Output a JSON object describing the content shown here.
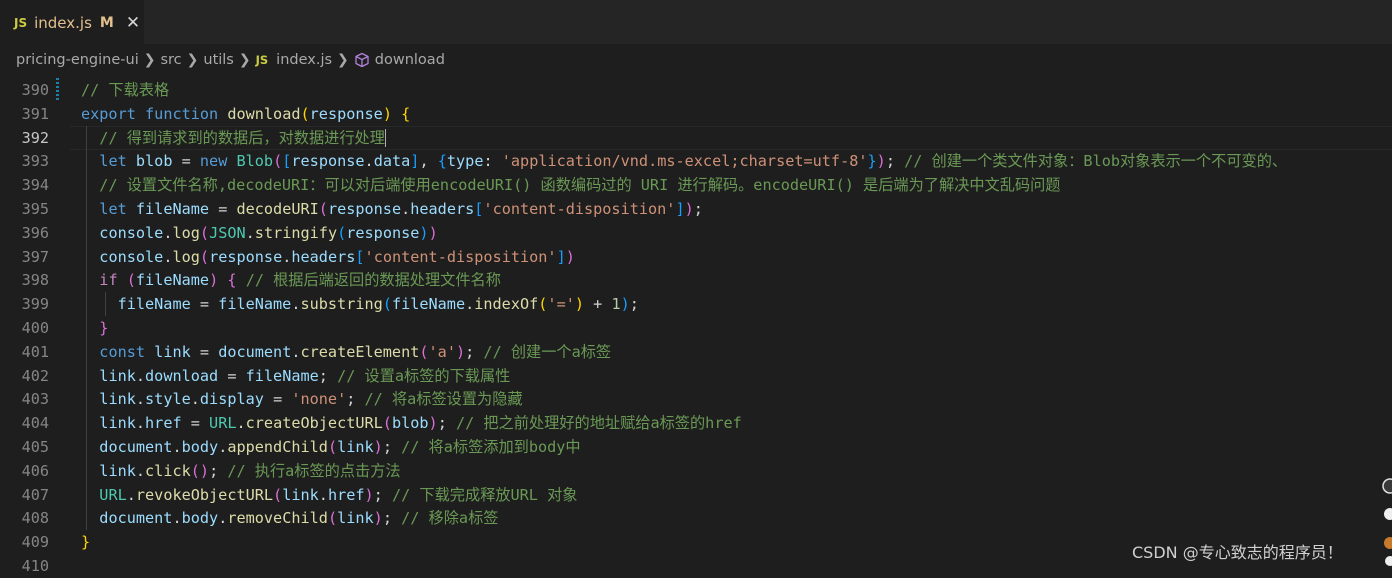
{
  "tab": {
    "icon": "JS",
    "filename": "index.js",
    "modified": "M",
    "close": "✕"
  },
  "breadcrumb": {
    "items": [
      "pricing-engine-ui",
      "src",
      "utils",
      "index.js",
      "download"
    ],
    "file_icon": "JS"
  },
  "lines": [
    {
      "n": "390",
      "tokens": [
        [
          "cmt",
          "// 下载表格"
        ]
      ]
    },
    {
      "n": "391",
      "tokens": [
        [
          "kw",
          "export"
        ],
        [
          "",
          " "
        ],
        [
          "kw",
          "function"
        ],
        [
          "",
          " "
        ],
        [
          "fn",
          "download"
        ],
        [
          "p1",
          "("
        ],
        [
          "var",
          "response"
        ],
        [
          "p1",
          ")"
        ],
        [
          "",
          " "
        ],
        [
          "p1",
          "{"
        ]
      ]
    },
    {
      "n": "392",
      "tokens": [
        [
          "",
          "  "
        ],
        [
          "cmt",
          "// 得到请求到的数据后，对数据进行处理"
        ]
      ]
    },
    {
      "n": "393",
      "tokens": [
        [
          "",
          "  "
        ],
        [
          "kw",
          "let"
        ],
        [
          "",
          " "
        ],
        [
          "var",
          "blob"
        ],
        [
          "",
          " = "
        ],
        [
          "kw",
          "new"
        ],
        [
          "",
          " "
        ],
        [
          "cls",
          "Blob"
        ],
        [
          "p2",
          "("
        ],
        [
          "p3",
          "["
        ],
        [
          "var",
          "response"
        ],
        [
          "",
          "."
        ],
        [
          "var",
          "data"
        ],
        [
          "p3",
          "]"
        ],
        [
          "",
          ", "
        ],
        [
          "p3",
          "{"
        ],
        [
          "var",
          "type"
        ],
        [
          "",
          ": "
        ],
        [
          "str",
          "'application/vnd.ms-excel;charset=utf-8'"
        ],
        [
          "p3",
          "}"
        ],
        [
          "p2",
          ")"
        ],
        [
          "",
          "; "
        ],
        [
          "cmt",
          "// 创建一个类文件对象：Blob对象表示一个不可变的、"
        ]
      ]
    },
    {
      "n": "394",
      "tokens": [
        [
          "",
          "  "
        ],
        [
          "cmt",
          "// 设置文件名称,decodeURI：可以对后端使用encodeURI() 函数编码过的 URI 进行解码。encodeURI() 是后端为了解决中文乱码问题"
        ]
      ]
    },
    {
      "n": "395",
      "tokens": [
        [
          "",
          "  "
        ],
        [
          "kw",
          "let"
        ],
        [
          "",
          " "
        ],
        [
          "var",
          "fileName"
        ],
        [
          "",
          " = "
        ],
        [
          "fn",
          "decodeURI"
        ],
        [
          "p2",
          "("
        ],
        [
          "var",
          "response"
        ],
        [
          "",
          "."
        ],
        [
          "var",
          "headers"
        ],
        [
          "p3",
          "["
        ],
        [
          "str",
          "'content-disposition'"
        ],
        [
          "p3",
          "]"
        ],
        [
          "p2",
          ")"
        ],
        [
          "",
          ";"
        ]
      ]
    },
    {
      "n": "396",
      "tokens": [
        [
          "",
          "  "
        ],
        [
          "var",
          "console"
        ],
        [
          "",
          "."
        ],
        [
          "fn",
          "log"
        ],
        [
          "p2",
          "("
        ],
        [
          "cls",
          "JSON"
        ],
        [
          "",
          "."
        ],
        [
          "fn",
          "stringify"
        ],
        [
          "p3",
          "("
        ],
        [
          "var",
          "response"
        ],
        [
          "p3",
          ")"
        ],
        [
          "p2",
          ")"
        ]
      ]
    },
    {
      "n": "397",
      "tokens": [
        [
          "",
          "  "
        ],
        [
          "var",
          "console"
        ],
        [
          "",
          "."
        ],
        [
          "fn",
          "log"
        ],
        [
          "p2",
          "("
        ],
        [
          "var",
          "response"
        ],
        [
          "",
          "."
        ],
        [
          "var",
          "headers"
        ],
        [
          "p3",
          "["
        ],
        [
          "str",
          "'content-disposition'"
        ],
        [
          "p3",
          "]"
        ],
        [
          "p2",
          ")"
        ]
      ]
    },
    {
      "n": "398",
      "tokens": [
        [
          "",
          "  "
        ],
        [
          "kw2",
          "if"
        ],
        [
          "",
          " "
        ],
        [
          "p2",
          "("
        ],
        [
          "var",
          "fileName"
        ],
        [
          "p2",
          ")"
        ],
        [
          "",
          " "
        ],
        [
          "p2",
          "{"
        ],
        [
          "",
          " "
        ],
        [
          "cmt",
          "// 根据后端返回的数据处理文件名称"
        ]
      ]
    },
    {
      "n": "399",
      "tokens": [
        [
          "",
          "    "
        ],
        [
          "var",
          "fileName"
        ],
        [
          "",
          " = "
        ],
        [
          "var",
          "fileName"
        ],
        [
          "",
          "."
        ],
        [
          "fn",
          "substring"
        ],
        [
          "p3",
          "("
        ],
        [
          "var",
          "fileName"
        ],
        [
          "",
          "."
        ],
        [
          "fn",
          "indexOf"
        ],
        [
          "p1",
          "("
        ],
        [
          "str",
          "'='"
        ],
        [
          "p1",
          ")"
        ],
        [
          "",
          " + "
        ],
        [
          "num",
          "1"
        ],
        [
          "p3",
          ")"
        ],
        [
          "",
          ";"
        ]
      ]
    },
    {
      "n": "400",
      "tokens": [
        [
          "",
          "  "
        ],
        [
          "p2",
          "}"
        ]
      ]
    },
    {
      "n": "401",
      "tokens": [
        [
          "",
          "  "
        ],
        [
          "kw",
          "const"
        ],
        [
          "",
          " "
        ],
        [
          "var",
          "link"
        ],
        [
          "",
          " = "
        ],
        [
          "var",
          "document"
        ],
        [
          "",
          "."
        ],
        [
          "fn",
          "createElement"
        ],
        [
          "p2",
          "("
        ],
        [
          "str",
          "'a'"
        ],
        [
          "p2",
          ")"
        ],
        [
          "",
          "; "
        ],
        [
          "cmt",
          "// 创建一个a标签"
        ]
      ]
    },
    {
      "n": "402",
      "tokens": [
        [
          "",
          "  "
        ],
        [
          "var",
          "link"
        ],
        [
          "",
          "."
        ],
        [
          "var",
          "download"
        ],
        [
          "",
          " = "
        ],
        [
          "var",
          "fileName"
        ],
        [
          "",
          "; "
        ],
        [
          "cmt",
          "// 设置a标签的下载属性"
        ]
      ]
    },
    {
      "n": "403",
      "tokens": [
        [
          "",
          "  "
        ],
        [
          "var",
          "link"
        ],
        [
          "",
          "."
        ],
        [
          "var",
          "style"
        ],
        [
          "",
          "."
        ],
        [
          "var",
          "display"
        ],
        [
          "",
          " = "
        ],
        [
          "str",
          "'none'"
        ],
        [
          "",
          "; "
        ],
        [
          "cmt",
          "// 将a标签设置为隐藏"
        ]
      ]
    },
    {
      "n": "404",
      "tokens": [
        [
          "",
          "  "
        ],
        [
          "var",
          "link"
        ],
        [
          "",
          "."
        ],
        [
          "var",
          "href"
        ],
        [
          "",
          " = "
        ],
        [
          "cls",
          "URL"
        ],
        [
          "",
          "."
        ],
        [
          "fn",
          "createObjectURL"
        ],
        [
          "p2",
          "("
        ],
        [
          "var",
          "blob"
        ],
        [
          "p2",
          ")"
        ],
        [
          "",
          "; "
        ],
        [
          "cmt",
          "// 把之前处理好的地址赋给a标签的href"
        ]
      ]
    },
    {
      "n": "405",
      "tokens": [
        [
          "",
          "  "
        ],
        [
          "var",
          "document"
        ],
        [
          "",
          "."
        ],
        [
          "var",
          "body"
        ],
        [
          "",
          "."
        ],
        [
          "fn",
          "appendChild"
        ],
        [
          "p2",
          "("
        ],
        [
          "var",
          "link"
        ],
        [
          "p2",
          ")"
        ],
        [
          "",
          "; "
        ],
        [
          "cmt",
          "// 将a标签添加到body中"
        ]
      ]
    },
    {
      "n": "406",
      "tokens": [
        [
          "",
          "  "
        ],
        [
          "var",
          "link"
        ],
        [
          "",
          "."
        ],
        [
          "fn",
          "click"
        ],
        [
          "p2",
          "("
        ],
        [
          "p2",
          ")"
        ],
        [
          "",
          "; "
        ],
        [
          "cmt",
          "// 执行a标签的点击方法"
        ]
      ]
    },
    {
      "n": "407",
      "tokens": [
        [
          "",
          "  "
        ],
        [
          "cls",
          "URL"
        ],
        [
          "",
          "."
        ],
        [
          "fn",
          "revokeObjectURL"
        ],
        [
          "p2",
          "("
        ],
        [
          "var",
          "link"
        ],
        [
          "",
          "."
        ],
        [
          "var",
          "href"
        ],
        [
          "p2",
          ")"
        ],
        [
          "",
          "; "
        ],
        [
          "cmt",
          "// 下载完成释放URL 对象"
        ]
      ]
    },
    {
      "n": "408",
      "tokens": [
        [
          "",
          "  "
        ],
        [
          "var",
          "document"
        ],
        [
          "",
          "."
        ],
        [
          "var",
          "body"
        ],
        [
          "",
          "."
        ],
        [
          "fn",
          "removeChild"
        ],
        [
          "p2",
          "("
        ],
        [
          "var",
          "link"
        ],
        [
          "p2",
          ")"
        ],
        [
          "",
          "; "
        ],
        [
          "cmt",
          "// 移除a标签"
        ]
      ]
    },
    {
      "n": "409",
      "tokens": [
        [
          "p1",
          "}"
        ]
      ]
    },
    {
      "n": "410",
      "tokens": []
    }
  ],
  "watermark": "CSDN @专心致志的程序员！",
  "colors": {
    "background": "#1e1e1e",
    "tab_modified": "#e2c08d",
    "comment": "#6a9955",
    "keyword": "#569cd6"
  }
}
